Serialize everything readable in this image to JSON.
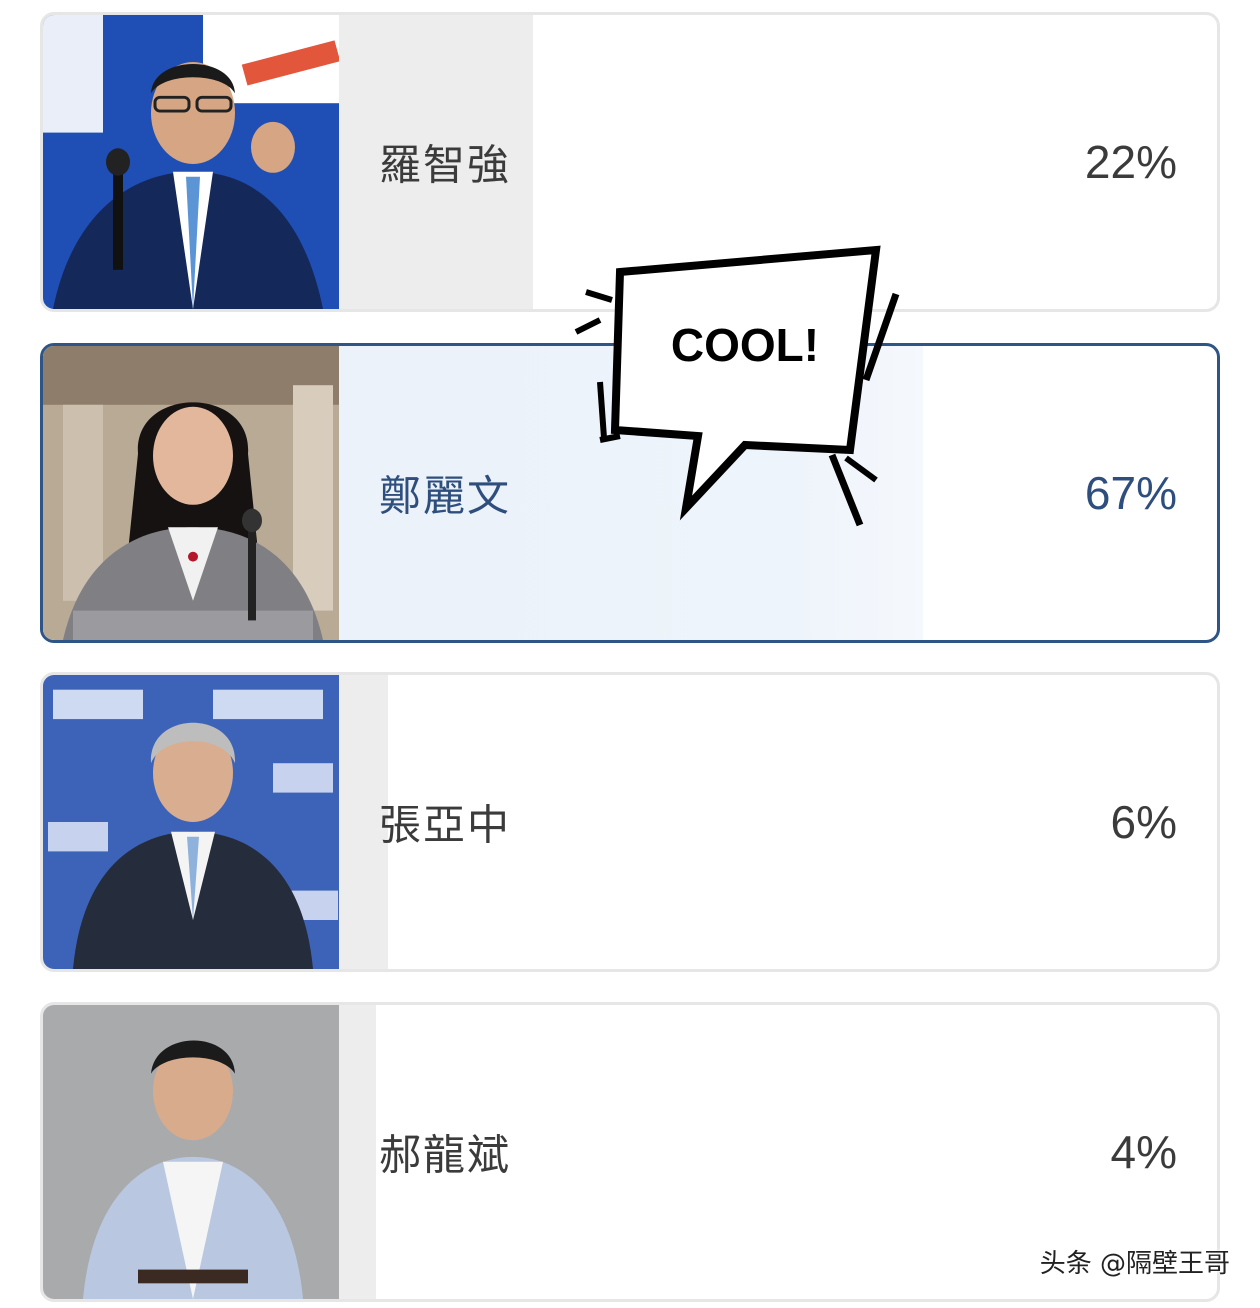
{
  "poll": {
    "options": [
      {
        "name": "羅智強",
        "percent_label": "22%",
        "share": 22,
        "selected": false
      },
      {
        "name": "鄭麗文",
        "percent_label": "67%",
        "share": 67,
        "selected": true
      },
      {
        "name": "張亞中",
        "percent_label": "6%",
        "share": 6,
        "selected": false
      },
      {
        "name": "郝龍斌",
        "percent_label": "4%",
        "share": 4,
        "selected": false
      }
    ]
  },
  "sticker": {
    "text": "COOL!"
  },
  "watermark": {
    "text": "头条 @隔壁王哥"
  },
  "colors": {
    "selected_border": "#2f5587",
    "selected_text": "#2e4f7e",
    "option_border": "#e6e6e6",
    "fill": "#ededed",
    "text": "#3b3b3b"
  }
}
